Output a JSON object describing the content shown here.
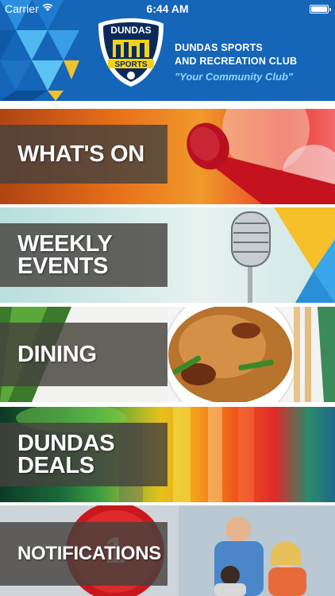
{
  "status_bar": {
    "carrier": "Carrier",
    "time": "6:44 AM",
    "battery_level": 1.0
  },
  "header": {
    "logo": {
      "top_text": "DUNDAS",
      "bottom_text": "SPORTS"
    },
    "club_name_line1": "DUNDAS SPORTS",
    "club_name_line2": "AND RECREATION CLUB",
    "tagline": "\"Your Community Club\""
  },
  "menu": {
    "items": [
      {
        "label": "WHAT'S ON",
        "icon": "microphone-image"
      },
      {
        "label": "WEEKLY\nEVENTS",
        "icon": "retro-microphone-image"
      },
      {
        "label": "DINING",
        "icon": "noodle-plate-image"
      },
      {
        "label": "DUNDAS\nDEALS",
        "icon": "colorful-stripes-image"
      },
      {
        "label": "NOTIFICATIONS",
        "icon": "people-dining-image"
      }
    ]
  },
  "colors": {
    "header_blue": "#1565b8",
    "tagline_blue": "#8fd8ff",
    "label_overlay": "#46423e"
  }
}
